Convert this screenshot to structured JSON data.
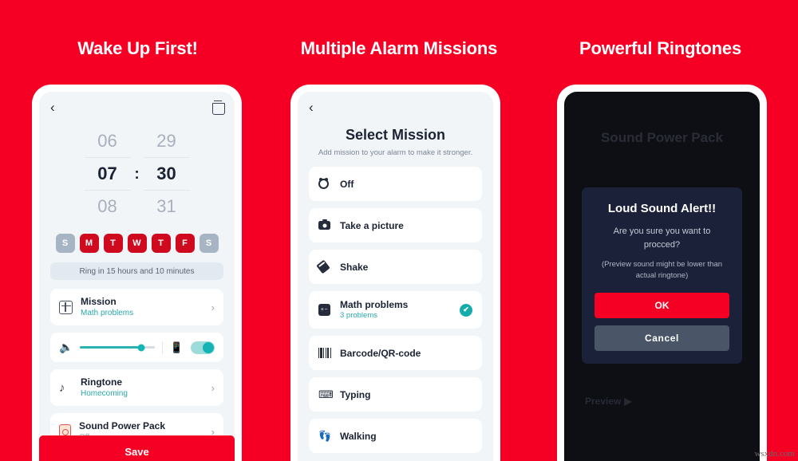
{
  "theme": {
    "background_red": "#F50024",
    "accent_teal": "#16ACAC",
    "day_active": "#CF0A1E",
    "day_inactive": "#A7B4C4",
    "dark_screen": "#0E0F14",
    "modal_bg": "#1B2138",
    "cancel_gray": "#4B5568"
  },
  "panels": [
    {
      "heading": "Wake Up First!"
    },
    {
      "heading": "Multiple Alarm Missions"
    },
    {
      "heading": "Powerful Ringtones"
    }
  ],
  "phone1": {
    "back_icon": "chevron-left-icon",
    "delete_icon": "trash-icon",
    "time_picker": {
      "above": {
        "hour": "06",
        "minute": "29"
      },
      "selected": {
        "hour": "07",
        "minute": "30",
        "separator": ":"
      },
      "below": {
        "hour": "08",
        "minute": "31"
      }
    },
    "days": [
      {
        "label": "S",
        "active": false
      },
      {
        "label": "M",
        "active": true
      },
      {
        "label": "T",
        "active": true
      },
      {
        "label": "W",
        "active": true
      },
      {
        "label": "T",
        "active": true
      },
      {
        "label": "F",
        "active": true
      },
      {
        "label": "S",
        "active": false
      }
    ],
    "ring_note": "Ring in 15 hours and 10 minutes",
    "rows": [
      {
        "icon": "grid-icon",
        "title": "Mission",
        "sub": "Math problems",
        "sub_color": "teal"
      },
      {
        "icon": "music-note-icon",
        "title": "Ringtone",
        "sub": "Homecoming",
        "sub_color": "teal"
      },
      {
        "icon": "speaker-box-icon",
        "title": "Sound Power Pack",
        "sub": "Off",
        "sub_color": "gray"
      }
    ],
    "volume": {
      "speaker_icon": "volume-icon",
      "level_percent": 82,
      "vibration_icon": "vibration-icon",
      "vibration_on": true
    },
    "save_label": "Save"
  },
  "phone2": {
    "back_icon": "chevron-left-icon",
    "title": "Select Mission",
    "subtitle": "Add mission to your alarm to make it stronger.",
    "missions": [
      {
        "icon": "alarm-clock-icon",
        "label": "Off",
        "sub": null,
        "selected": false
      },
      {
        "icon": "camera-icon",
        "label": "Take a picture",
        "sub": null,
        "selected": false
      },
      {
        "icon": "shake-icon",
        "label": "Shake",
        "sub": null,
        "selected": false
      },
      {
        "icon": "math-grid-icon",
        "label": "Math problems",
        "sub": "3 problems",
        "selected": true
      },
      {
        "icon": "barcode-icon",
        "label": "Barcode/QR-code",
        "sub": null,
        "selected": false
      },
      {
        "icon": "keyboard-icon",
        "label": "Typing",
        "sub": null,
        "selected": false
      },
      {
        "icon": "footprints-icon",
        "label": "Walking",
        "sub": null,
        "selected": false
      }
    ],
    "check_glyph": "✔"
  },
  "phone3": {
    "background_title": "Sound Power Pack",
    "dialog": {
      "heading": "Loud Sound Alert!!",
      "question": "Are you sure you want to procced?",
      "note": "(Preview sound might be lower than actual ringtone)",
      "ok_label": "OK",
      "cancel_label": "Cancel"
    },
    "preview_label": "Preview",
    "preview_icon": "play-icon"
  },
  "watermark": "wsxdn.com"
}
